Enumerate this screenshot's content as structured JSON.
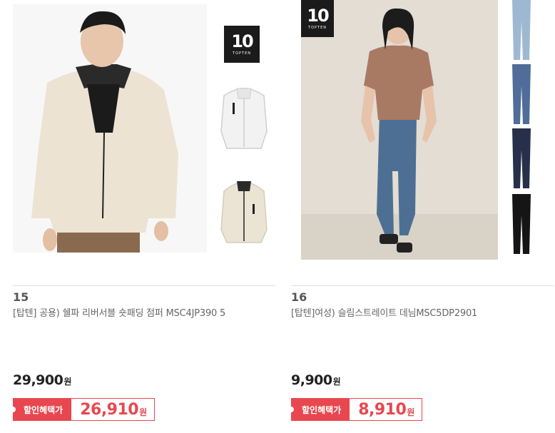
{
  "products": [
    {
      "rank": "15",
      "name": "[탑텐] 공용) 쉘파 리버서블 숏패딩 점퍼 MSC4JP390 5",
      "price": "29,900",
      "price_unit": "원",
      "discount_label": "할인혜택가",
      "discount_price": "26,910",
      "discount_unit": "원",
      "brand_logo": {
        "number": "10",
        "text": "TOPTEN"
      }
    },
    {
      "rank": "16",
      "name": "[탑텐]여성) 슬림스트레이트 데님MSC5DP2901",
      "price": "9,900",
      "price_unit": "원",
      "discount_label": "할인혜택가",
      "discount_price": "8,910",
      "discount_unit": "원",
      "brand_logo": {
        "number": "10",
        "text": "TOPTEN"
      }
    }
  ],
  "colors": {
    "accent": "#e8474f",
    "text": "#333333",
    "muted": "#666666"
  }
}
